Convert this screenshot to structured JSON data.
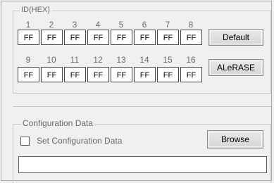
{
  "id_group": {
    "legend": "ID(HEX)",
    "row1": [
      {
        "index": "1",
        "value": "FF"
      },
      {
        "index": "2",
        "value": "FF"
      },
      {
        "index": "3",
        "value": "FF"
      },
      {
        "index": "4",
        "value": "FF"
      },
      {
        "index": "5",
        "value": "FF"
      },
      {
        "index": "6",
        "value": "FF"
      },
      {
        "index": "7",
        "value": "FF"
      },
      {
        "index": "8",
        "value": "FF"
      }
    ],
    "row2": [
      {
        "index": "9",
        "value": "FF"
      },
      {
        "index": "10",
        "value": "FF"
      },
      {
        "index": "11",
        "value": "FF"
      },
      {
        "index": "12",
        "value": "FF"
      },
      {
        "index": "13",
        "value": "FF"
      },
      {
        "index": "14",
        "value": "FF"
      },
      {
        "index": "15",
        "value": "FF"
      },
      {
        "index": "16",
        "value": "FF"
      }
    ],
    "default_button": "Default",
    "alerase_button": "ALeRASE"
  },
  "config_group": {
    "legend": "Configuration Data",
    "checkbox_label": "Set Configuration Data",
    "checkbox_checked": false,
    "browse_button": "Browse",
    "path_value": ""
  }
}
